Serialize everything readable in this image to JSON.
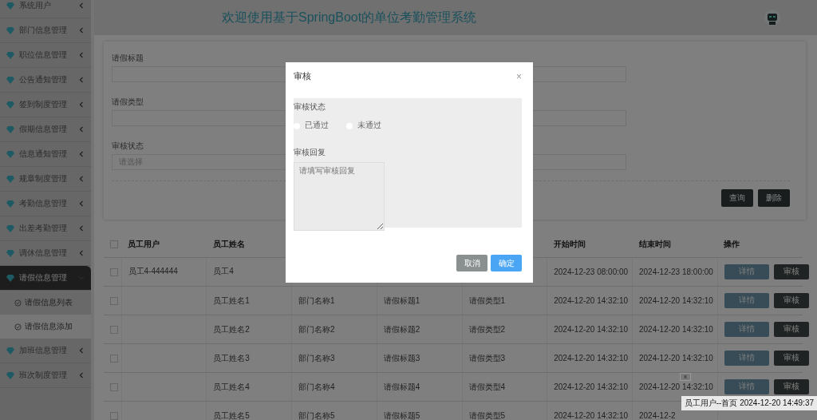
{
  "sidebar": {
    "items": [
      {
        "label": "系统用户",
        "expanded": false,
        "selected": false
      },
      {
        "label": "部门信息管理",
        "expanded": false,
        "selected": false
      },
      {
        "label": "职位信息管理",
        "expanded": false,
        "selected": false
      },
      {
        "label": "公告通知管理",
        "expanded": false,
        "selected": false
      },
      {
        "label": "签到制度管理",
        "expanded": false,
        "selected": false
      },
      {
        "label": "假期信息管理",
        "expanded": false,
        "selected": false
      },
      {
        "label": "信息通知管理",
        "expanded": false,
        "selected": false
      },
      {
        "label": "规章制度管理",
        "expanded": false,
        "selected": false
      },
      {
        "label": "考勤信息管理",
        "expanded": false,
        "selected": false
      },
      {
        "label": "出差考勤管理",
        "expanded": false,
        "selected": false
      },
      {
        "label": "调休信息管理",
        "expanded": false,
        "selected": false
      },
      {
        "label": "请假信息管理",
        "expanded": true,
        "selected": true,
        "children": [
          {
            "label": "请假信息列表",
            "selected": false
          },
          {
            "label": "请假信息添加",
            "selected": true
          }
        ]
      },
      {
        "label": "加班信息管理",
        "expanded": false,
        "selected": false
      },
      {
        "label": "班次制度管理",
        "expanded": false,
        "selected": false
      }
    ]
  },
  "header": {
    "title": "欢迎使用基于SpringBoot的单位考勤管理系统"
  },
  "filter": {
    "fields": [
      {
        "label": "请假标题",
        "kind": "input"
      },
      {
        "label": "请假类型",
        "kind": "input"
      },
      {
        "label": "审核状态",
        "kind": "select",
        "placeholder": "请选择"
      }
    ],
    "buttons": [
      "查询",
      "删除"
    ]
  },
  "table": {
    "header_checked": false,
    "columns": [
      {
        "label": "员工用户"
      },
      {
        "label": "员工姓名"
      },
      {},
      {},
      {},
      {
        "label": "开始时间"
      },
      {
        "label": "结束时间"
      },
      {
        "label": "操作"
      }
    ],
    "rows": [
      {
        "checked": false,
        "user": "员工4-444444",
        "name": "员工4",
        "start": "2024-12-23 08:00:00",
        "end": "2024-12-23 18:00:00",
        "actions": [
          "详情",
          "审核"
        ]
      },
      {
        "checked": false,
        "name": "员工姓名1",
        "dept": "部门名称1",
        "title": "请假标题1",
        "type": "请假类型1",
        "start": "2024-12-20 14:32:10",
        "end": "2024-12-20 14:32:10",
        "actions": [
          "详情",
          "审核"
        ]
      },
      {
        "checked": false,
        "name": "员工姓名2",
        "dept": "部门名称2",
        "title": "请假标题2",
        "type": "请假类型2",
        "start": "2024-12-20 14:32:10",
        "end": "2024-12-20 14:32:10",
        "actions": [
          "详情",
          "审核"
        ]
      },
      {
        "checked": false,
        "name": "员工姓名3",
        "dept": "部门名称3",
        "title": "请假标题3",
        "type": "请假类型3",
        "start": "2024-12-20 14:32:10",
        "end": "2024-12-20 14:32:10",
        "actions": [
          "详情",
          "审核"
        ]
      },
      {
        "checked": false,
        "name": "员工姓名4",
        "dept": "部门名称4",
        "title": "请假标题4",
        "type": "请假类型4",
        "start": "2024-12-20 14:32:10",
        "end": "2024-12-20 14:32:10",
        "actions": [
          "详情",
          "审核"
        ]
      },
      {
        "checked": false,
        "name": "员工姓名5",
        "dept": "部门名称5",
        "title": "请假标题5",
        "type": "请假类型5",
        "start": "2024-12-20 14:32:10",
        "end": "2024-12-2"
      }
    ]
  },
  "dialog": {
    "title": "审核",
    "close": "×",
    "status_label": "审核状态",
    "options": [
      {
        "label": "已通过",
        "selected": false
      },
      {
        "label": "未通过",
        "selected": false
      }
    ],
    "reply_label": "审核回复",
    "reply_placeholder": "请填写审核回复",
    "buttons": [
      {
        "label": "取消",
        "kind": "cancel"
      },
      {
        "label": "确定",
        "kind": "primary"
      }
    ]
  },
  "toast": {
    "close": "x",
    "text": "员工用户--首页 2024-12-20 14:49:37"
  }
}
